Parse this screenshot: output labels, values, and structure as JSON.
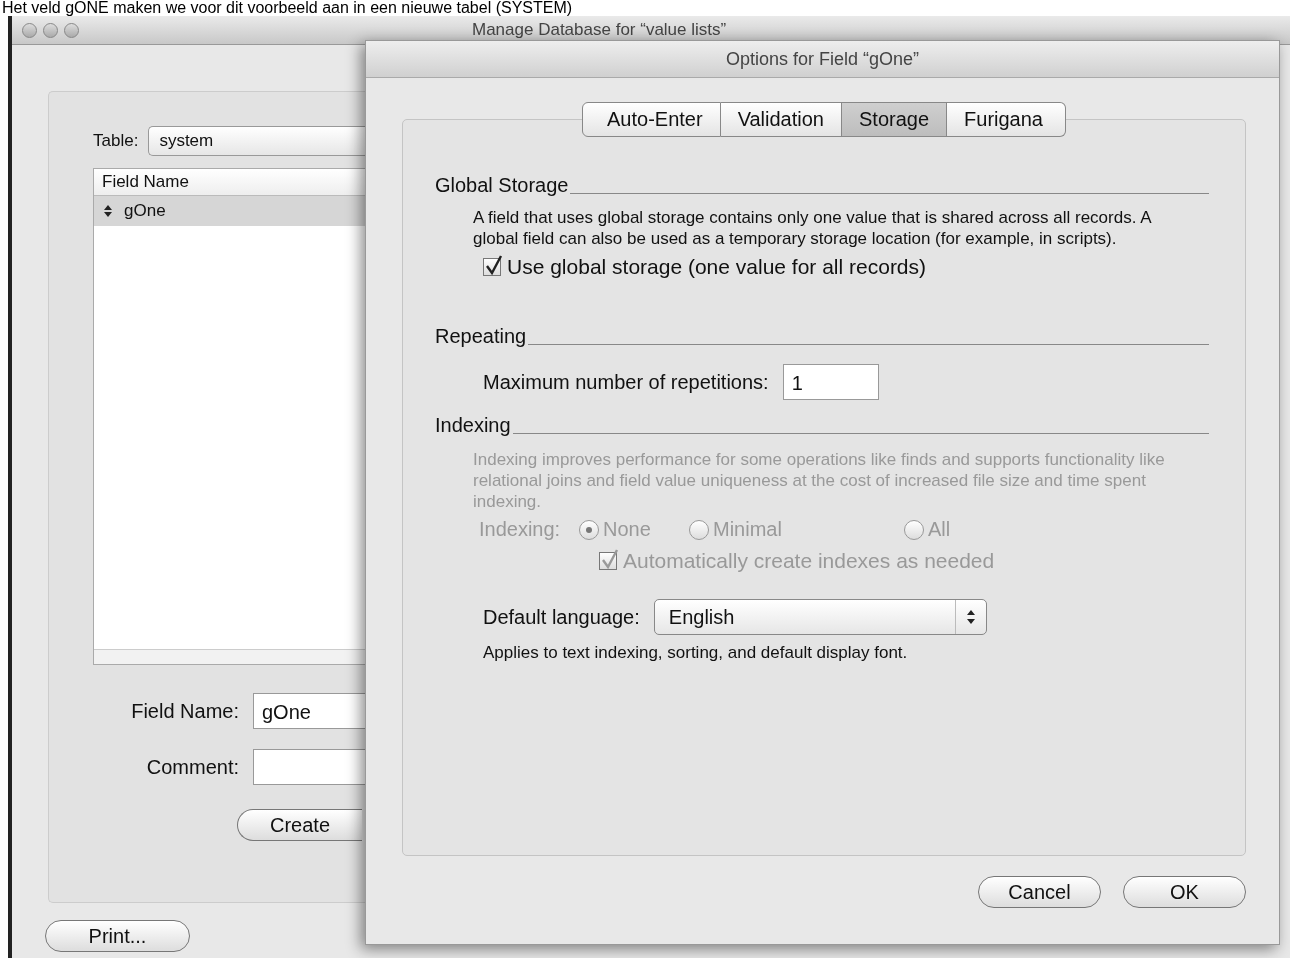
{
  "caption": "Het veld gONE maken we voor dit voorbeeld aan in een nieuwe tabel (SYSTEM)",
  "main_window": {
    "title": "Manage Database for “value lists”",
    "table_label": "Table:",
    "table_value": "system",
    "list": {
      "header": "Field Name",
      "rows": [
        {
          "name": "gOne",
          "selected": true
        }
      ]
    },
    "field_name_label": "Field Name:",
    "field_name_value": "gOne",
    "comment_label": "Comment:",
    "create_button": "Create",
    "print_button": "Print..."
  },
  "dialog": {
    "title": "Options for Field “gOne”",
    "tabs": [
      {
        "label": "Auto-Enter",
        "selected": false
      },
      {
        "label": "Validation",
        "selected": false
      },
      {
        "label": "Storage",
        "selected": true
      },
      {
        "label": "Furigana",
        "selected": false
      }
    ],
    "global_storage": {
      "heading": "Global Storage",
      "description": "A field that uses global storage contains only one value that is shared across all records.  A global field can also be used as a temporary storage location (for example, in scripts).",
      "checkbox": {
        "label": "Use global storage (one value for all records)",
        "checked": true
      }
    },
    "repeating": {
      "heading": "Repeating",
      "label": "Maximum number of repetitions:",
      "value": "1"
    },
    "indexing": {
      "heading": "Indexing",
      "disabled": true,
      "description": "Indexing improves performance for some operations like finds and supports functionality like relational joins and field value uniqueness at the cost of increased file size and time spent indexing.",
      "label": "Indexing:",
      "options": [
        {
          "label": "None",
          "selected": true
        },
        {
          "label": "Minimal",
          "selected": false
        },
        {
          "label": "All",
          "selected": false
        }
      ],
      "auto_checkbox": {
        "label": "Automatically create indexes as needed",
        "checked": true
      },
      "language_label": "Default language:",
      "language_value": "English",
      "note": "Applies to text indexing, sorting, and default display font."
    },
    "buttons": [
      {
        "label": "Cancel"
      },
      {
        "label": "OK"
      }
    ]
  }
}
